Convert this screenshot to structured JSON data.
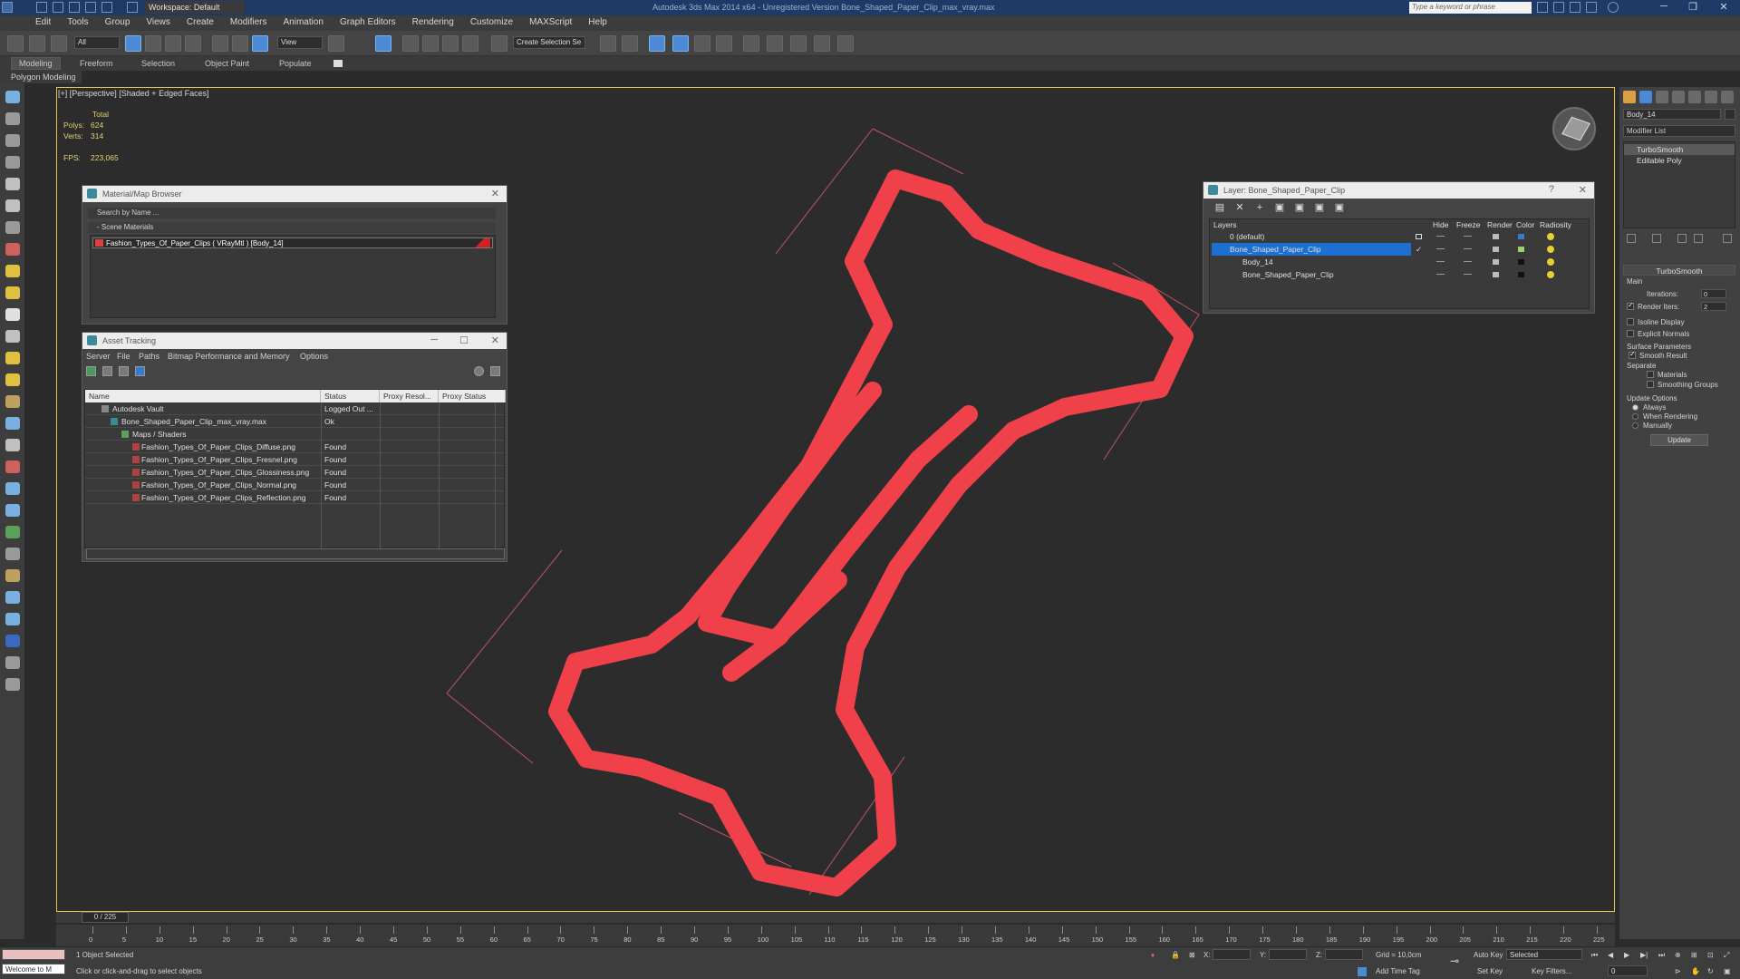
{
  "titlebar": {
    "workspace": "Workspace: Default",
    "title": "Autodesk 3ds Max  2014 x64   -  Unregistered Version    Bone_Shaped_Paper_Clip_max_vray.max",
    "search_placeholder": "Type a keyword or phrase"
  },
  "menu": [
    "Edit",
    "Tools",
    "Group",
    "Views",
    "Create",
    "Modifiers",
    "Animation",
    "Graph Editors",
    "Rendering",
    "Customize",
    "MAXScript",
    "Help"
  ],
  "toolbar": {
    "filter": "All",
    "refcoord": "View",
    "selection_set": "Create Selection Se"
  },
  "ribbon": {
    "tabs": [
      "Modeling",
      "Freeform",
      "Selection",
      "Object Paint",
      "Populate"
    ],
    "sub": "Polygon Modeling"
  },
  "viewport": {
    "label": "[+] [Perspective] [Shaded + Edged Faces]",
    "stats": {
      "total_label": "Total",
      "polys_label": "Polys:",
      "polys": "624",
      "verts_label": "Verts:",
      "verts": "314",
      "fps_label": "FPS:",
      "fps": "223,065"
    }
  },
  "material_browser": {
    "title": "Material/Map Browser",
    "search_placeholder": "Search by Name ...",
    "section": "- Scene Materials",
    "item": "Fashion_Types_Of_Paper_Clips  ( VRayMtl ) [Body_14]"
  },
  "asset_tracking": {
    "title": "Asset Tracking",
    "menu": [
      "Server",
      "File",
      "Paths",
      "Bitmap Performance and Memory",
      "Options"
    ],
    "columns": [
      "Name",
      "Status",
      "Proxy Resol...",
      "Proxy Status"
    ],
    "rows": [
      {
        "name": "Autodesk Vault",
        "status": "Logged Out ..."
      },
      {
        "name": "Bone_Shaped_Paper_Clip_max_vray.max",
        "status": "Ok"
      },
      {
        "name": "Maps / Shaders",
        "status": ""
      },
      {
        "name": "Fashion_Types_Of_Paper_Clips_Diffuse.png",
        "status": "Found"
      },
      {
        "name": "Fashion_Types_Of_Paper_Clips_Fresnel.png",
        "status": "Found"
      },
      {
        "name": "Fashion_Types_Of_Paper_Clips_Glossiness.png",
        "status": "Found"
      },
      {
        "name": "Fashion_Types_Of_Paper_Clips_Normal.png",
        "status": "Found"
      },
      {
        "name": "Fashion_Types_Of_Paper_Clips_Reflection.png",
        "status": "Found"
      }
    ]
  },
  "layer_window": {
    "title": "Layer: Bone_Shaped_Paper_Clip",
    "columns": [
      "Layers",
      "Hide",
      "Freeze",
      "Render",
      "Color",
      "Radiosity"
    ],
    "rows": [
      {
        "name": "0 (default)"
      },
      {
        "name": "Bone_Shaped_Paper_Clip"
      },
      {
        "name": "Body_14"
      },
      {
        "name": "Bone_Shaped_Paper_Clip"
      }
    ]
  },
  "command_panel": {
    "object_name": "Body_14",
    "modifier_list": "Modifier List",
    "stack": [
      "TurboSmooth",
      "Editable Poly"
    ],
    "rollout_title": "TurboSmooth",
    "main_label": "Main",
    "iterations_label": "Iterations:",
    "iterations": "0",
    "render_iters_label": "Render Iters:",
    "render_iters": "2",
    "isoline": "Isoline Display",
    "explicit_normals": "Explicit Normals",
    "surface_params": "Surface Parameters",
    "smooth_result": "Smooth Result",
    "separate": "Separate",
    "materials": "Materials",
    "smoothing_groups": "Smoothing Groups",
    "update_options": "Update Options",
    "always": "Always",
    "when_rendering": "When Rendering",
    "manually": "Manually",
    "update_button": "Update"
  },
  "timeline": {
    "frame": "0 / 225",
    "ticks": [
      "0",
      "5",
      "10",
      "15",
      "20",
      "25",
      "30",
      "35",
      "40",
      "45",
      "50",
      "55",
      "60",
      "65",
      "70",
      "75",
      "80",
      "85",
      "90",
      "95",
      "100",
      "105",
      "110",
      "115",
      "120",
      "125",
      "130",
      "135",
      "140",
      "145",
      "150",
      "155",
      "160",
      "165",
      "170",
      "175",
      "180",
      "185",
      "190",
      "195",
      "200",
      "205",
      "210",
      "215",
      "220",
      "225"
    ]
  },
  "status": {
    "maxscript": "Welcome to M",
    "selected": "1 Object Selected",
    "prompt": "Click or click-and-drag to select objects",
    "x_label": "X:",
    "y_label": "Y:",
    "z_label": "Z:",
    "grid": "Grid = 10,0cm",
    "add_time_tag": "Add Time Tag",
    "auto_key": "Auto Key",
    "set_key": "Set Key",
    "selected_dropdown": "Selected",
    "key_filters": "Key Filters...",
    "frame_field": "0"
  },
  "colors": {
    "clip": "#f0404a",
    "accent": "#1d6fd1",
    "viewport_border": "#e9c34a"
  }
}
